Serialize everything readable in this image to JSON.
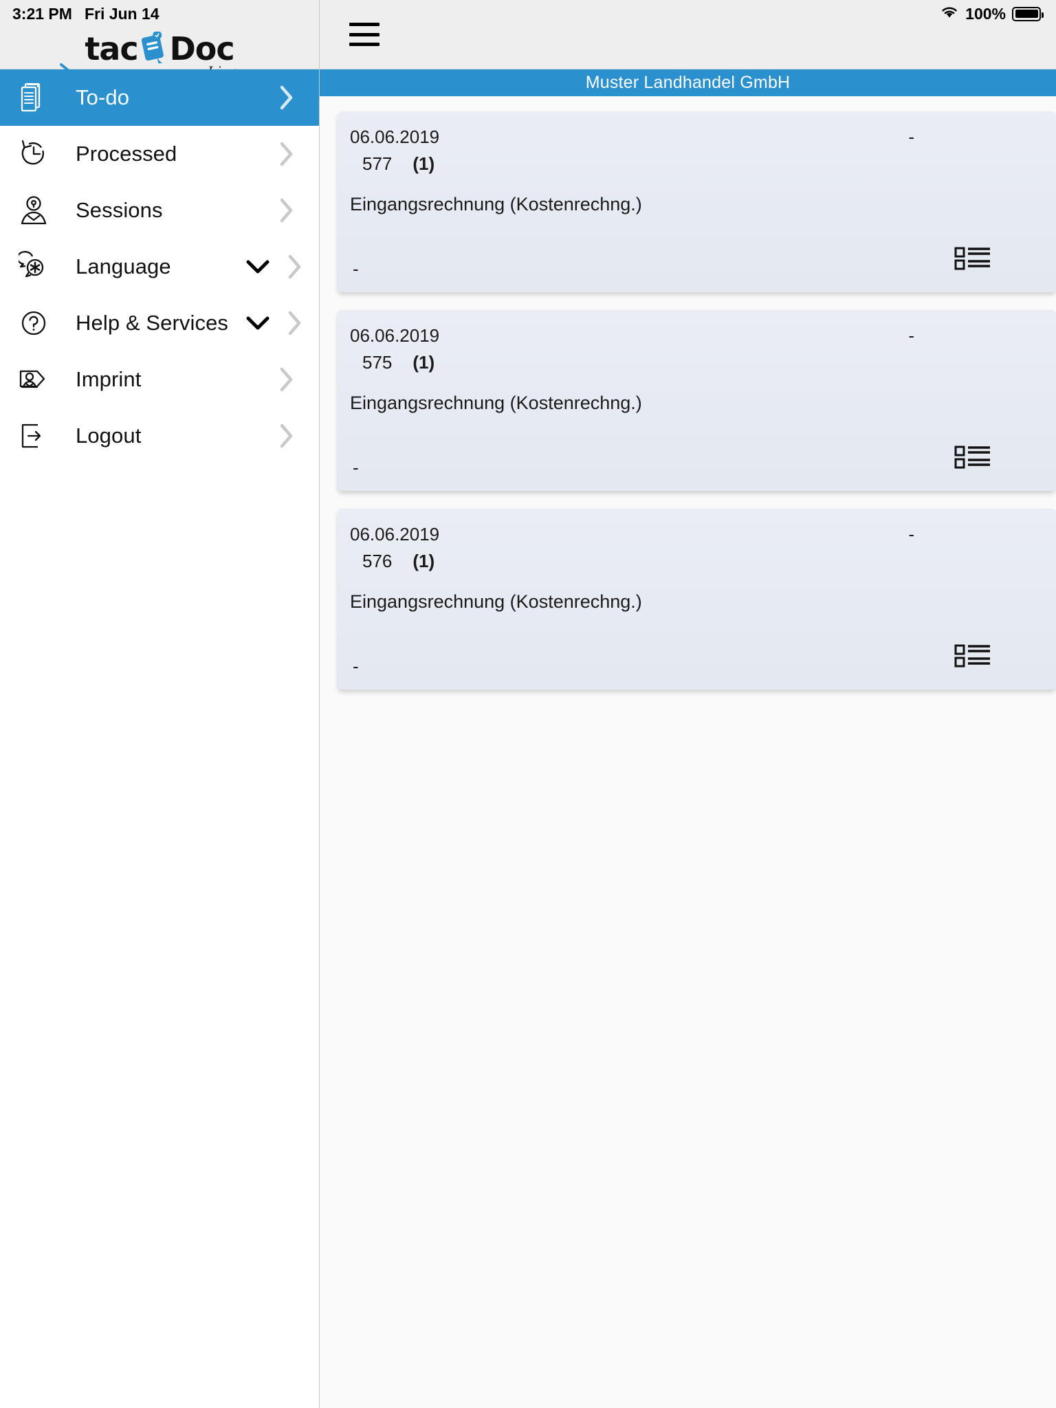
{
  "status_bar": {
    "time": "3:21 PM",
    "date": "Fri Jun 14",
    "battery_percent": "100%",
    "wifi_icon": "wifi-icon",
    "battery_icon": "battery-full-icon"
  },
  "brand": {
    "name_part1": "tac",
    "name_part2": "Doc",
    "tagline": "Live",
    "logo_icon": "tacdoc-clipboard-icon",
    "accent_color": "#2a91ce"
  },
  "sidebar": {
    "items": [
      {
        "label": "To-do",
        "icon": "documents-stack-icon",
        "active": true,
        "expandable": false,
        "chevron": "chevron-right-icon"
      },
      {
        "label": "Processed",
        "icon": "clock-history-icon",
        "active": false,
        "expandable": false,
        "chevron": "chevron-right-icon"
      },
      {
        "label": "Sessions",
        "icon": "user-key-icon",
        "active": false,
        "expandable": false,
        "chevron": "chevron-right-icon"
      },
      {
        "label": "Language",
        "icon": "speech-bubbles-icon",
        "active": false,
        "expandable": true,
        "chevron": "chevron-right-icon",
        "expander": "chevron-down-icon"
      },
      {
        "label": "Help & Services",
        "icon": "question-circle-icon",
        "active": false,
        "expandable": true,
        "chevron": "chevron-right-icon",
        "expander": "chevron-down-icon"
      },
      {
        "label": "Imprint",
        "icon": "contact-tag-icon",
        "active": false,
        "expandable": false,
        "chevron": "chevron-right-icon"
      },
      {
        "label": "Logout",
        "icon": "logout-arrow-icon",
        "active": false,
        "expandable": false,
        "chevron": "chevron-right-icon"
      }
    ]
  },
  "topbar": {
    "menu_icon": "hamburger-menu-icon"
  },
  "company_bar": {
    "title": "Muster Landhandel GmbH"
  },
  "documents": [
    {
      "date": "06.06.2019",
      "right_value": "-",
      "number": "577",
      "count": "(1)",
      "type": "Eingangsrechnung (Kostenrechng.)",
      "note": "-",
      "action_icon": "list-detail-icon"
    },
    {
      "date": "06.06.2019",
      "right_value": "-",
      "number": "575",
      "count": "(1)",
      "type": "Eingangsrechnung (Kostenrechng.)",
      "note": "-",
      "action_icon": "list-detail-icon"
    },
    {
      "date": "06.06.2019",
      "right_value": "-",
      "number": "576",
      "count": "(1)",
      "type": "Eingangsrechnung (Kostenrechng.)",
      "note": "-",
      "action_icon": "list-detail-icon"
    }
  ]
}
